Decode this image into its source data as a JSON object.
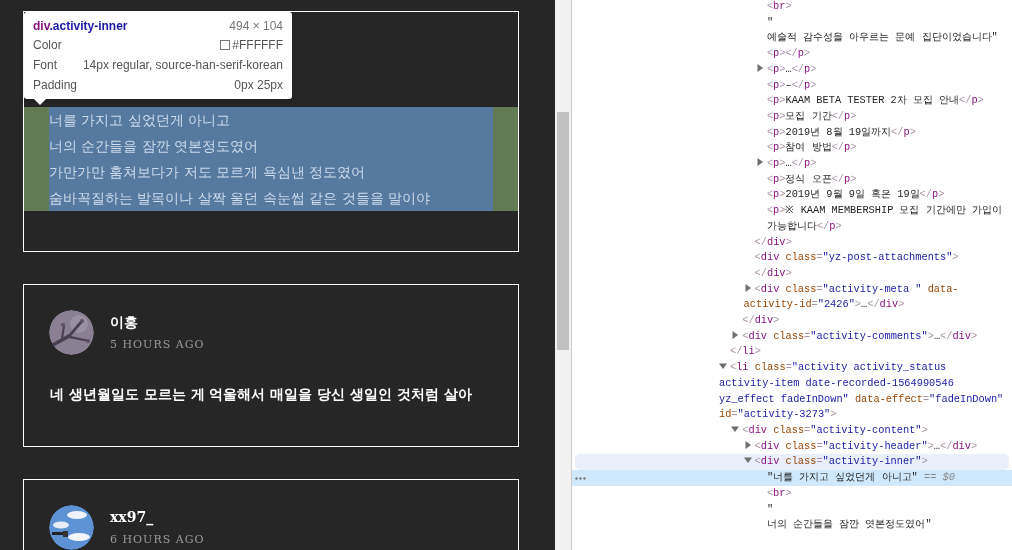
{
  "feed": {
    "cards": [
      {
        "kind": "inspected",
        "lines": [
          "너를 가지고 싶었던게 아니고",
          "너의 순간들을 잠깐 엿본정도였어",
          "가만가만 훔쳐보다가 저도 모르게 욕심낸 정도였어",
          "숨바꼭질하는 발목이나 살짝 울던 속눈썹 같은 것들을 말이야"
        ]
      },
      {
        "kind": "post",
        "author": "이홍",
        "time": "5 HOURS AGO",
        "text": "네 생년월일도 모르는 게 억울해서 매일을 당신 생일인 것처럼 살아"
      },
      {
        "kind": "post",
        "author": "xx97_",
        "time": "6 HOURS AGO"
      }
    ]
  },
  "inspect_tooltip": {
    "tag": "div",
    "class_name": ".activity-inner",
    "size": "494 × 104",
    "rows": [
      {
        "label": "Color",
        "value": "#FFFFFF",
        "color": "#ffffff"
      },
      {
        "label": "Font",
        "value": "14px regular, source-han-serif-korean"
      },
      {
        "label": "Padding",
        "value": "0px 25px"
      }
    ]
  },
  "elements_tree": {
    "console_ref": "== $0",
    "nodes": [
      {
        "kind": "partial",
        "close": [
          {
            "kind": "punct",
            "text": "</"
          },
          {
            "kind": "tag",
            "text": "li"
          },
          {
            "kind": "punct",
            "text": ">"
          }
        ],
        "children": [
          {
            "kind": "partial",
            "close": [
              {
                "kind": "punct",
                "text": "</"
              },
              {
                "kind": "tag",
                "text": "div"
              },
              {
                "kind": "punct",
                "text": ">"
              }
            ],
            "children": [
              {
                "kind": "partial",
                "close": [
                  {
                    "kind": "punct",
                    "text": "</"
                  },
                  {
                    "kind": "tag",
                    "text": "div"
                  },
                  {
                    "kind": "punct",
                    "text": ">"
                  }
                ],
                "children": [
                  {
                    "kind": "element",
                    "selected": false,
                    "open": [
                      {
                        "kind": "punct",
                        "text": "<"
                      },
                      {
                        "kind": "tag",
                        "text": "br"
                      },
                      {
                        "kind": "punct",
                        "text": ">"
                      }
                    ]
                  },
                  {
                    "kind": "text",
                    "selected": false,
                    "lines": [
                      "\"",
                      "예술적 감수성을 아우르는 문예 집단이었습니다\""
                    ]
                  },
                  {
                    "kind": "element",
                    "selected": false,
                    "open": [
                      {
                        "kind": "punct",
                        "text": "<"
                      },
                      {
                        "kind": "tag",
                        "text": "p"
                      },
                      {
                        "kind": "punct",
                        "text": "></"
                      },
                      {
                        "kind": "tag",
                        "text": "p"
                      },
                      {
                        "kind": "punct",
                        "text": ">"
                      }
                    ]
                  },
                  {
                    "kind": "element",
                    "selected": false,
                    "expanded": false,
                    "open": [
                      {
                        "kind": "punct",
                        "text": "<"
                      },
                      {
                        "kind": "tag",
                        "text": "p"
                      },
                      {
                        "kind": "punct",
                        "text": ">"
                      },
                      {
                        "kind": "text",
                        "text": "…"
                      },
                      {
                        "kind": "punct",
                        "text": "</"
                      },
                      {
                        "kind": "tag",
                        "text": "p"
                      },
                      {
                        "kind": "punct",
                        "text": ">"
                      }
                    ]
                  },
                  {
                    "kind": "element",
                    "selected": false,
                    "open": [
                      {
                        "kind": "punct",
                        "text": "<"
                      },
                      {
                        "kind": "tag",
                        "text": "p"
                      },
                      {
                        "kind": "punct",
                        "text": ">"
                      },
                      {
                        "kind": "text",
                        "text": "–"
                      },
                      {
                        "kind": "punct",
                        "text": "</"
                      },
                      {
                        "kind": "tag",
                        "text": "p"
                      },
                      {
                        "kind": "punct",
                        "text": ">"
                      }
                    ]
                  },
                  {
                    "kind": "element",
                    "selected": false,
                    "open": [
                      {
                        "kind": "punct",
                        "text": "<"
                      },
                      {
                        "kind": "tag",
                        "text": "p"
                      },
                      {
                        "kind": "punct",
                        "text": ">"
                      },
                      {
                        "kind": "text",
                        "text": "KAAM BETA TESTER 2차 모집 안내"
                      },
                      {
                        "kind": "punct",
                        "text": "</"
                      },
                      {
                        "kind": "tag",
                        "text": "p"
                      },
                      {
                        "kind": "punct",
                        "text": ">"
                      }
                    ]
                  },
                  {
                    "kind": "element",
                    "selected": false,
                    "open": [
                      {
                        "kind": "punct",
                        "text": "<"
                      },
                      {
                        "kind": "tag",
                        "text": "p"
                      },
                      {
                        "kind": "punct",
                        "text": ">"
                      },
                      {
                        "kind": "text",
                        "text": "모집 기간"
                      },
                      {
                        "kind": "punct",
                        "text": "</"
                      },
                      {
                        "kind": "tag",
                        "text": "p"
                      },
                      {
                        "kind": "punct",
                        "text": ">"
                      }
                    ]
                  },
                  {
                    "kind": "element",
                    "selected": false,
                    "open": [
                      {
                        "kind": "punct",
                        "text": "<"
                      },
                      {
                        "kind": "tag",
                        "text": "p"
                      },
                      {
                        "kind": "punct",
                        "text": ">"
                      },
                      {
                        "kind": "text",
                        "text": "2019년 8월 19일까지"
                      },
                      {
                        "kind": "punct",
                        "text": "</"
                      },
                      {
                        "kind": "tag",
                        "text": "p"
                      },
                      {
                        "kind": "punct",
                        "text": ">"
                      }
                    ]
                  },
                  {
                    "kind": "element",
                    "selected": false,
                    "open": [
                      {
                        "kind": "punct",
                        "text": "<"
                      },
                      {
                        "kind": "tag",
                        "text": "p"
                      },
                      {
                        "kind": "punct",
                        "text": ">"
                      },
                      {
                        "kind": "text",
                        "text": "참여 방법"
                      },
                      {
                        "kind": "punct",
                        "text": "</"
                      },
                      {
                        "kind": "tag",
                        "text": "p"
                      },
                      {
                        "kind": "punct",
                        "text": ">"
                      }
                    ]
                  },
                  {
                    "kind": "element",
                    "selected": false,
                    "expanded": false,
                    "open": [
                      {
                        "kind": "punct",
                        "text": "<"
                      },
                      {
                        "kind": "tag",
                        "text": "p"
                      },
                      {
                        "kind": "punct",
                        "text": ">"
                      },
                      {
                        "kind": "text",
                        "text": "…"
                      },
                      {
                        "kind": "punct",
                        "text": "</"
                      },
                      {
                        "kind": "tag",
                        "text": "p"
                      },
                      {
                        "kind": "punct",
                        "text": ">"
                      }
                    ]
                  },
                  {
                    "kind": "element",
                    "selected": false,
                    "open": [
                      {
                        "kind": "punct",
                        "text": "<"
                      },
                      {
                        "kind": "tag",
                        "text": "p"
                      },
                      {
                        "kind": "punct",
                        "text": ">"
                      },
                      {
                        "kind": "text",
                        "text": "정식 오픈"
                      },
                      {
                        "kind": "punct",
                        "text": "</"
                      },
                      {
                        "kind": "tag",
                        "text": "p"
                      },
                      {
                        "kind": "punct",
                        "text": ">"
                      }
                    ]
                  },
                  {
                    "kind": "element",
                    "selected": false,
                    "open": [
                      {
                        "kind": "punct",
                        "text": "<"
                      },
                      {
                        "kind": "tag",
                        "text": "p"
                      },
                      {
                        "kind": "punct",
                        "text": ">"
                      },
                      {
                        "kind": "text",
                        "text": "2019년 9월 9일 혹은 19일"
                      },
                      {
                        "kind": "punct",
                        "text": "</"
                      },
                      {
                        "kind": "tag",
                        "text": "p"
                      },
                      {
                        "kind": "punct",
                        "text": ">"
                      }
                    ]
                  },
                  {
                    "kind": "element",
                    "selected": false,
                    "open": [
                      {
                        "kind": "punct",
                        "text": "<"
                      },
                      {
                        "kind": "tag",
                        "text": "p"
                      },
                      {
                        "kind": "punct",
                        "text": ">"
                      },
                      {
                        "kind": "text",
                        "text": "※ KAAM MEMBERSHIP 모집 기간에만 가입이 가능합니다"
                      },
                      {
                        "kind": "punct",
                        "text": "</"
                      },
                      {
                        "kind": "tag",
                        "text": "p"
                      },
                      {
                        "kind": "punct",
                        "text": ">"
                      }
                    ]
                  }
                ]
              },
              {
                "kind": "element",
                "selected": false,
                "open": [
                  {
                    "kind": "punct",
                    "text": "<"
                  },
                  {
                    "kind": "tag",
                    "text": "div"
                  },
                  {
                    "kind": "attr",
                    "text": " class"
                  },
                  {
                    "kind": "punct",
                    "text": "="
                  },
                  {
                    "kind": "value",
                    "text": "\"yz-post-attachments\""
                  },
                  {
                    "kind": "punct",
                    "text": ">"
                  }
                ],
                "close": [
                  {
                    "kind": "punct",
                    "text": "</"
                  },
                  {
                    "kind": "tag",
                    "text": "div"
                  },
                  {
                    "kind": "punct",
                    "text": ">"
                  }
                ]
              },
              {
                "kind": "element",
                "selected": false,
                "expanded": false,
                "open": [
                  {
                    "kind": "punct",
                    "text": "<"
                  },
                  {
                    "kind": "tag",
                    "text": "div"
                  },
                  {
                    "kind": "attr",
                    "text": " class"
                  },
                  {
                    "kind": "punct",
                    "text": "="
                  },
                  {
                    "kind": "value",
                    "text": "\"activity-meta \""
                  },
                  {
                    "kind": "attr",
                    "text": " data-activity-id"
                  },
                  {
                    "kind": "punct",
                    "text": "="
                  },
                  {
                    "kind": "value",
                    "text": "\"2426\""
                  },
                  {
                    "kind": "punct",
                    "text": ">"
                  },
                  {
                    "kind": "text",
                    "text": "…"
                  },
                  {
                    "kind": "punct",
                    "text": "</"
                  },
                  {
                    "kind": "tag",
                    "text": "div"
                  },
                  {
                    "kind": "punct",
                    "text": ">"
                  }
                ]
              }
            ]
          },
          {
            "kind": "element",
            "selected": false,
            "expanded": false,
            "open": [
              {
                "kind": "punct",
                "text": "<"
              },
              {
                "kind": "tag",
                "text": "div"
              },
              {
                "kind": "attr",
                "text": " class"
              },
              {
                "kind": "punct",
                "text": "="
              },
              {
                "kind": "value",
                "text": "\"activity-comments\""
              },
              {
                "kind": "punct",
                "text": ">"
              },
              {
                "kind": "text",
                "text": "…"
              },
              {
                "kind": "punct",
                "text": "</"
              },
              {
                "kind": "tag",
                "text": "div"
              },
              {
                "kind": "punct",
                "text": ">"
              }
            ]
          }
        ]
      },
      {
        "kind": "element",
        "selected": false,
        "expanded": true,
        "open": [
          {
            "kind": "punct",
            "text": "<"
          },
          {
            "kind": "tag",
            "text": "li"
          },
          {
            "kind": "attr",
            "text": " class"
          },
          {
            "kind": "punct",
            "text": "="
          },
          {
            "kind": "value",
            "text": "\"activity activity_status activity-item date-recorded-1564990546 yz_effect fadeInDown\""
          },
          {
            "kind": "attr",
            "text": " data-effect"
          },
          {
            "kind": "punct",
            "text": "="
          },
          {
            "kind": "value",
            "text": "\"fadeInDown\""
          },
          {
            "kind": "attr",
            "text": " id"
          },
          {
            "kind": "punct",
            "text": "="
          },
          {
            "kind": "value",
            "text": "\"activity-3273\""
          },
          {
            "kind": "punct",
            "text": ">"
          }
        ],
        "children": [
          {
            "kind": "element",
            "selected": false,
            "expanded": true,
            "open": [
              {
                "kind": "punct",
                "text": "<"
              },
              {
                "kind": "tag",
                "text": "div"
              },
              {
                "kind": "attr",
                "text": " class"
              },
              {
                "kind": "punct",
                "text": "="
              },
              {
                "kind": "value",
                "text": "\"activity-content\""
              },
              {
                "kind": "punct",
                "text": ">"
              }
            ],
            "children": [
              {
                "kind": "element",
                "selected": false,
                "expanded": false,
                "open": [
                  {
                    "kind": "punct",
                    "text": "<"
                  },
                  {
                    "kind": "tag",
                    "text": "div"
                  },
                  {
                    "kind": "attr",
                    "text": " class"
                  },
                  {
                    "kind": "punct",
                    "text": "="
                  },
                  {
                    "kind": "value",
                    "text": "\"activity-header\""
                  },
                  {
                    "kind": "punct",
                    "text": ">"
                  },
                  {
                    "kind": "text",
                    "text": "…"
                  },
                  {
                    "kind": "punct",
                    "text": "</"
                  },
                  {
                    "kind": "tag",
                    "text": "div"
                  },
                  {
                    "kind": "punct",
                    "text": ">"
                  }
                ]
              },
              {
                "kind": "element",
                "selected": false,
                "expanded": true,
                "open": [
                  {
                    "kind": "punct",
                    "text": "<"
                  },
                  {
                    "kind": "tag",
                    "text": "div"
                  },
                  {
                    "kind": "attr",
                    "text": " class"
                  },
                  {
                    "kind": "punct",
                    "text": "="
                  },
                  {
                    "kind": "value",
                    "text": "\"activity-inner\""
                  },
                  {
                    "kind": "punct",
                    "text": ">"
                  }
                ],
                "children": [
                  {
                    "kind": "text",
                    "selected": true,
                    "lines": [
                      "\"너를 가지고 싶었던게 아니고\""
                    ]
                  },
                  {
                    "kind": "element",
                    "selected": false,
                    "open": [
                      {
                        "kind": "punct",
                        "text": "<"
                      },
                      {
                        "kind": "tag",
                        "text": "br"
                      },
                      {
                        "kind": "punct",
                        "text": ">"
                      }
                    ]
                  },
                  {
                    "kind": "text",
                    "selected": false,
                    "lines": [
                      "\"",
                      "너의 순간들을 잠깐 엿본정도였어\""
                    ]
                  }
                ]
              }
            ]
          }
        ]
      }
    ]
  }
}
